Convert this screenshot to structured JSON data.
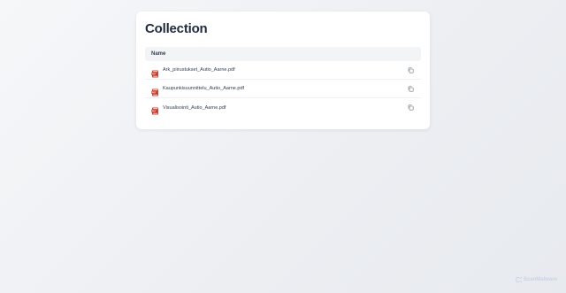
{
  "page": {
    "title": "Collection"
  },
  "table": {
    "header_name": "Name",
    "files": [
      {
        "name": "Ark_piirustukset_Autio_Aarne.pdf",
        "icon": "pdf-icon"
      },
      {
        "name": "Kaupunkisuunnittelu_Autio_Aarne.pdf",
        "icon": "pdf-icon"
      },
      {
        "name": "Visualisointi_Autio_Aarne.pdf",
        "icon": "pdf-icon"
      }
    ]
  },
  "brand": {
    "label": "ScanMalware",
    "icon": "scanmalware-logo-icon"
  },
  "colors": {
    "pdf_red": "#d93a2b",
    "title": "#1f2a3c",
    "brand": "#c8d3e6"
  }
}
